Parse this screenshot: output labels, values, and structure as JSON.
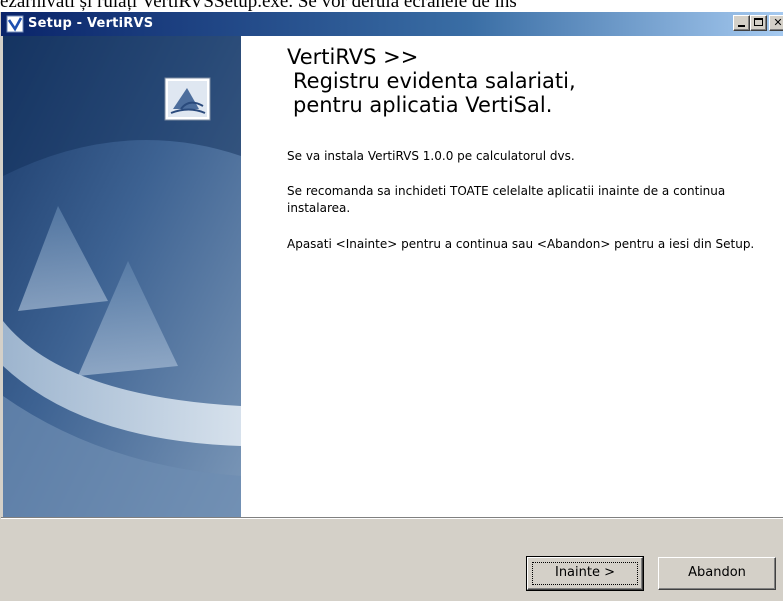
{
  "document_fragment": "ezarhivati și rulați VertiRVSSetup.exe. Se vor derula ecranele de ins",
  "window": {
    "title": "Setup - VertiRVS"
  },
  "content": {
    "heading": {
      "line1": "VertiRVS >>",
      "line2": "Registru evidenta salariati,",
      "line3": "pentru aplicatia VertiSal."
    },
    "paragraph1": "Se va instala VertiRVS 1.0.0 pe calculatorul dvs.",
    "paragraph2": "Se recomanda sa inchideti TOATE celelalte aplicatii inainte de a continua instalarea.",
    "paragraph3": "Apasati <Inainte> pentru a continua sau <Abandon> pentru a iesi din Setup."
  },
  "buttons": {
    "next": "Inainte >",
    "cancel": "Abandon"
  },
  "colors": {
    "titlebar_start": "#0a246a",
    "titlebar_end": "#a6caf0",
    "panel_dark": "#1c3d6e",
    "panel_light": "#8aa6c4",
    "dialog_face": "#d4d0c8"
  }
}
